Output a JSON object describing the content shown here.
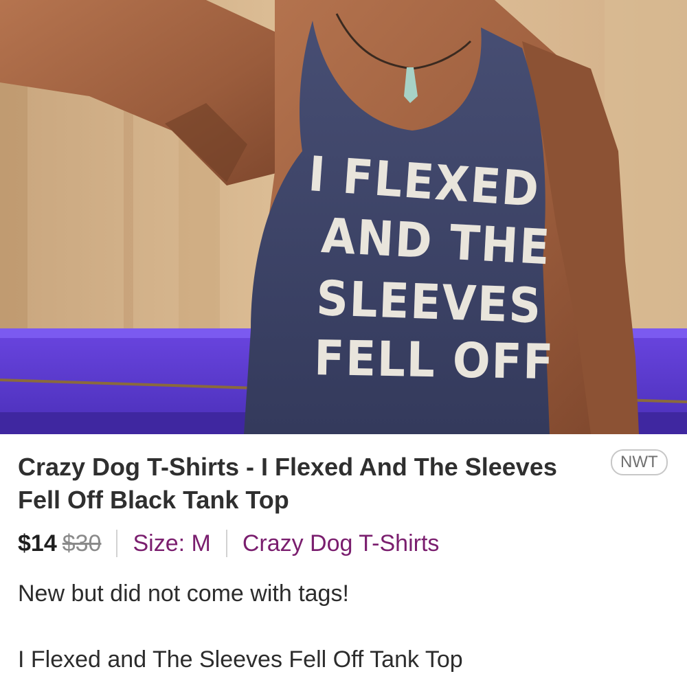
{
  "listing": {
    "photo_alt": "Man wearing a blue racerback tank top",
    "shirt_print": [
      "I FLEXED",
      "AND THE",
      "SLEEVES",
      "FELL OFF"
    ],
    "title": "Crazy Dog T-Shirts - I Flexed And The Sleeves Fell Off Black Tank Top",
    "condition_badge": "NWT",
    "price": "$14",
    "original_price": "$30",
    "size": "Size: M",
    "brand": "Crazy Dog T-Shirts",
    "description": [
      "New but did not come with tags!",
      "I Flexed and The Sleeves Fell Off Tank Top"
    ]
  },
  "colors": {
    "accent": "#7a1e6e",
    "price": "#1f1f1f",
    "muted": "#8a8a8a",
    "tank": "#3d4468",
    "railing": "#5533c9"
  }
}
